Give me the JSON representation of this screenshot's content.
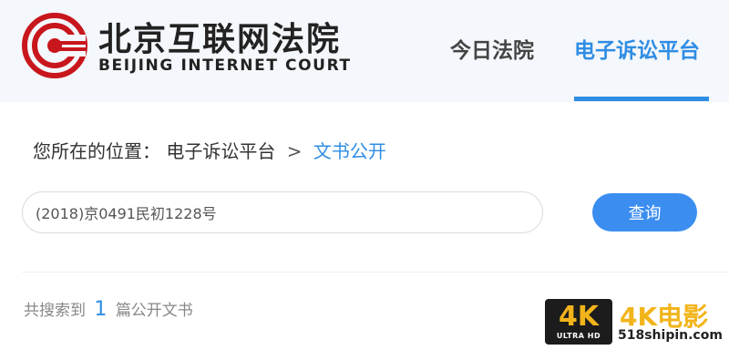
{
  "header": {
    "brand_cn": "北京互联网法院",
    "brand_en": "BEIJING INTERNET COURT",
    "nav": [
      {
        "label": "今日法院",
        "active": false
      },
      {
        "label": "电子诉讼平台",
        "active": true
      }
    ],
    "accent_color": "#2f8de4",
    "logo_color": "#c8161d"
  },
  "breadcrumb": {
    "prefix": "您所在的位置：",
    "items": [
      {
        "label": "电子诉讼平台"
      },
      {
        "label": "文书公开"
      }
    ],
    "separator": ">"
  },
  "search": {
    "value": "(2018)京0491民初1228号",
    "button_label": "查询"
  },
  "results": {
    "prefix": "共搜索到",
    "count": "1",
    "suffix": "篇公开文书"
  },
  "watermark": {
    "badge_main": "4K",
    "badge_sub": "ULTRA HD",
    "title": "4K电影",
    "url": "518shipin.com"
  }
}
